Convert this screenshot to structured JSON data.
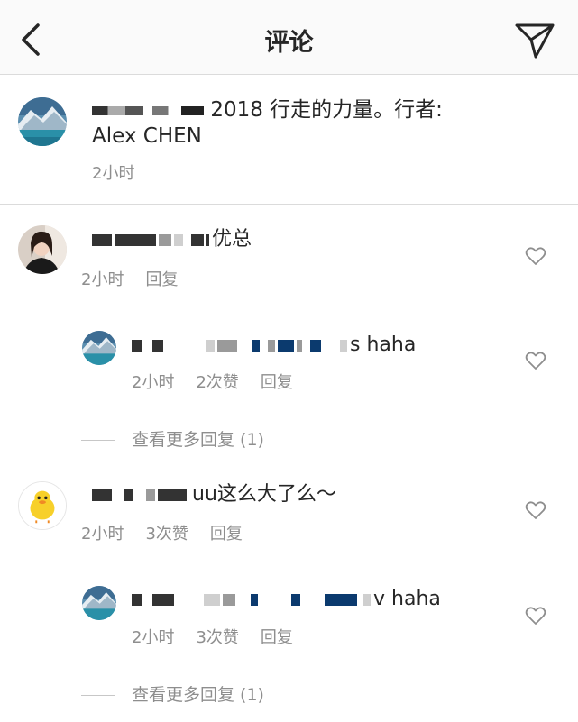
{
  "header": {
    "title": "评论",
    "back_icon": "chevron-left-icon",
    "send_icon": "paper-plane-icon"
  },
  "post": {
    "caption": "2018 行走的力量。行者: Alex CHEN",
    "time": "2小时"
  },
  "comments": [
    {
      "text": "优总",
      "time": "2小时",
      "reply": "回复",
      "replies": [
        {
          "text": "s haha",
          "time": "2小时",
          "likes": "2次赞",
          "reply": "回复"
        }
      ],
      "view_more": "查看更多回复 (1)"
    },
    {
      "text": "uu这么大了么～",
      "time": "2小时",
      "likes": "3次赞",
      "reply": "回复",
      "replies": [
        {
          "text": "v haha",
          "time": "2小时",
          "likes": "3次赞",
          "reply": "回复"
        }
      ],
      "view_more": "查看更多回复 (1)"
    }
  ],
  "colors": {
    "header_bg": "#fafafa",
    "text": "#262626",
    "meta": "#8e8e8e",
    "divider": "#dbdbdb"
  }
}
